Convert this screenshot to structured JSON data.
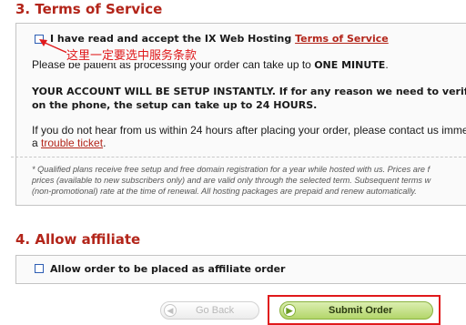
{
  "section3": {
    "title": "3. Terms of Service",
    "agree_text": "I have read and accept the IX Web Hosting ",
    "agree_link": "Terms of Service",
    "annotation": "这里一定要选中服务条款",
    "patience_text": "Please be patient as processing your order can take up to ",
    "patience_bold": "ONE MINUTE",
    "patience_end": ".",
    "setup_line1": "YOUR ACCOUNT WILL BE SETUP INSTANTLY. If for any reason we need to verify y",
    "setup_line2": "on the phone, the setup can take up to 24 HOURS.",
    "contact_line1": "If you do not hear from us within 24 hours after placing your order, please contact us imme",
    "contact_prefix": "a ",
    "contact_link": "trouble ticket",
    "contact_end": ".",
    "fine_line1": "* Qualified plans receive free setup and free domain registration for a year while hosted with us. Prices are f",
    "fine_line2": "prices (available to new subscribers only) and are valid only through the selected term. Subsequent terms w",
    "fine_line3": "(non-promotional) rate at the time of renewal. All hosting packages are prepaid and renew automatically."
  },
  "section4": {
    "title": "4. Allow affiliate",
    "affiliate_label": "Allow order to be placed as affiliate order"
  },
  "buttons": {
    "go_back": "Go Back",
    "submit": "Submit Order"
  },
  "colors": {
    "section_title": "#b3251a",
    "annotation": "#e0191b",
    "submit_green": "#b3d66a"
  },
  "icons": {
    "go_back": "arrow-left-icon",
    "submit": "arrow-right-icon"
  }
}
